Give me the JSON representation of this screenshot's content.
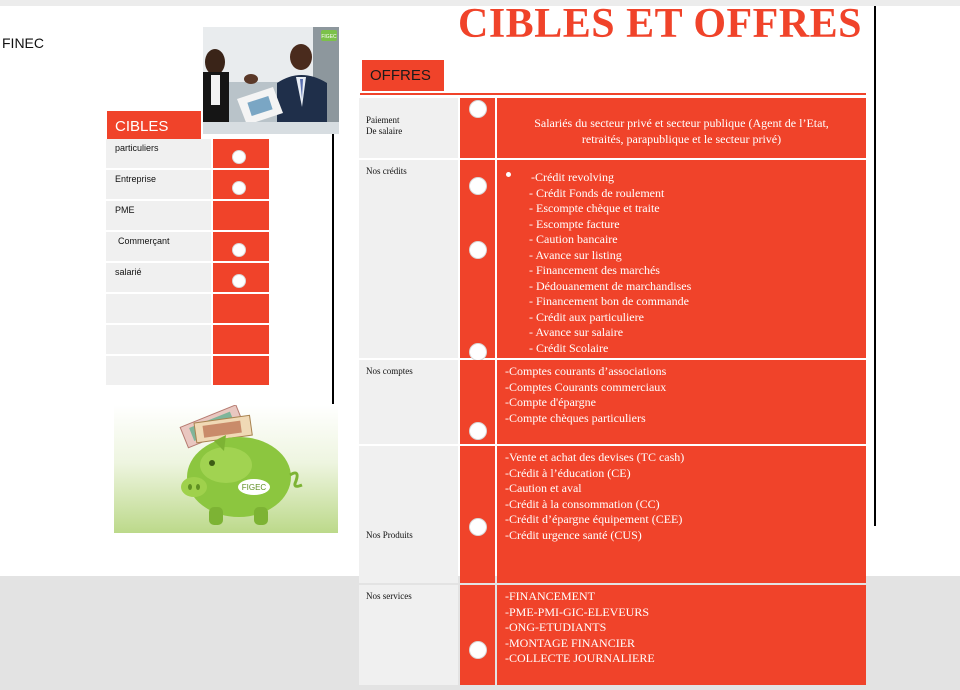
{
  "header": {
    "brand": "FINEC",
    "title": "CIBLES  ET OFFRES"
  },
  "photo": {
    "logo_text": "FIGEC"
  },
  "cibles": {
    "title": "CIBLES",
    "rows": [
      {
        "label": "particuliers",
        "selected_mark": true
      },
      {
        "label": "Entreprise",
        "selected_mark": true
      },
      {
        "label": "PME",
        "selected_mark": false
      },
      {
        "label": "Commerçant",
        "selected_mark": true
      },
      {
        "label": "salarié",
        "selected_mark": true
      },
      {
        "label": "",
        "selected_mark": false
      },
      {
        "label": "",
        "selected_mark": false
      },
      {
        "label": "",
        "selected_mark": false
      }
    ]
  },
  "piggy": {
    "logo_text": "FIGEC"
  },
  "offres": {
    "title": "OFFRES",
    "rows": [
      {
        "label_lines": [
          "Paiement",
          "De salaire"
        ],
        "lines": [
          "Salariés du secteur privé et secteur publique (Agent de l’Etat,",
          "retraités, parapublique  et  le secteur privé)"
        ]
      },
      {
        "label_lines": [
          "Nos crédits"
        ],
        "lines": [
          "-Crédit revolving",
          "- Crédit Fonds de roulement",
          "- Escompte chèque et traite",
          "- Escompte facture",
          "- Caution bancaire",
          "- Avance sur listing",
          "- Financement des marchés",
          "- Dédouanement de marchandises",
          "- Financement bon de commande",
          "- Crédit aux particuliere",
          "- Avance sur salaire",
          "- Crédit Scolaire"
        ]
      },
      {
        "label_lines": [
          "Nos comptes"
        ],
        "lines": [
          "-Comptes courants d’associations",
          "-Comptes Courants commerciaux",
          "-Compte d'épargne",
          "-Compte chèques particuliers"
        ]
      },
      {
        "label_lines": [
          "Nos Produits"
        ],
        "lines": [
          "-Vente et achat des devises (TC cash)",
          "-Crédit à l’éducation (CE)",
          "-Caution et aval",
          "-Crédit à la consommation (CC)",
          "-Crédit d’épargne équipement (CEE)",
          "-Crédit urgence santé (CUS)"
        ]
      },
      {
        "label_lines": [
          "Nos services"
        ],
        "lines": [
          "-FINANCEMENT",
          "-PME-PMI-GIC-ELEVEURS",
          "-ONG-ETUDIANTS",
          "-MONTAGE FINANCIER",
          "-COLLECTE JOURNALIERE"
        ]
      }
    ]
  },
  "colors": {
    "accent": "#f0432a",
    "label_bg": "#f0f0f0",
    "page_bg": "#ffffff",
    "outer_bg": "#e3e3e3"
  }
}
